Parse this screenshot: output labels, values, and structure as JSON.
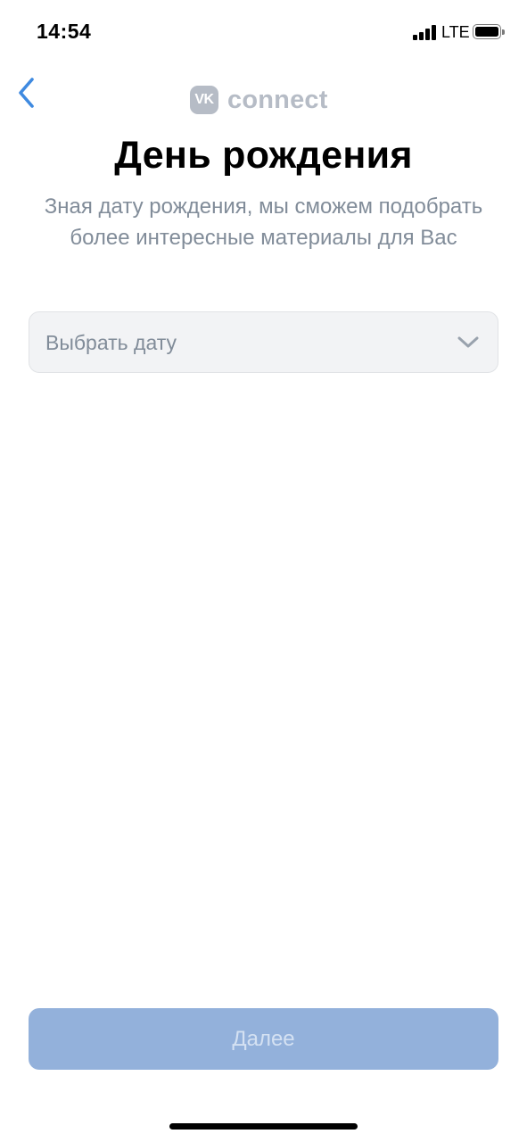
{
  "status_bar": {
    "time": "14:54",
    "network": "LTE",
    "icons": [
      "signal-icon",
      "battery-icon"
    ]
  },
  "header": {
    "back_icon": "chevron-left-icon",
    "logo_badge": "VK",
    "logo_text": "connect"
  },
  "main": {
    "title": "День рождения",
    "subtitle": "Зная дату рождения, мы сможем подобрать более интересные материалы для Вас",
    "date_select": {
      "placeholder": "Выбрать дату",
      "icon": "chevron-down-icon"
    },
    "next_button_label": "Далее"
  },
  "colors": {
    "accent": "#3f8ae0",
    "button_disabled": "#93b1db",
    "secondary_text": "#818c99",
    "field_background": "#f2f3f5",
    "logo_gray": "#b6bcc6"
  }
}
